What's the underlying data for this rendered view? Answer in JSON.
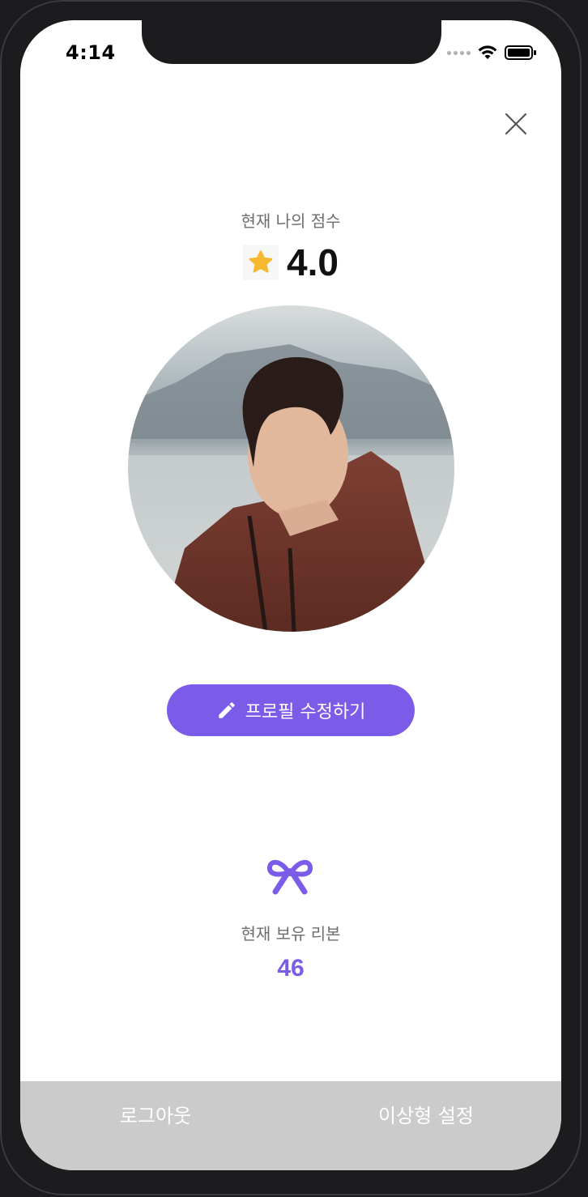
{
  "status_bar": {
    "time": "4:14"
  },
  "score": {
    "label": "현재 나의 점수",
    "value": "4.0",
    "icon": "star-icon",
    "star_color": "#f5b82e"
  },
  "profile": {
    "photo": "profile-photo"
  },
  "edit_profile": {
    "label": "프로필 수정하기",
    "icon": "pencil-icon",
    "color": "#7b5ce8"
  },
  "ribbon": {
    "icon": "ribbon-icon",
    "label": "현재 보유 리본",
    "count": "46",
    "color": "#7b5ce8"
  },
  "bottom_bar": {
    "logout_label": "로그아웃",
    "ideal_type_label": "이상형 설정",
    "background": "#cbcbcb"
  }
}
